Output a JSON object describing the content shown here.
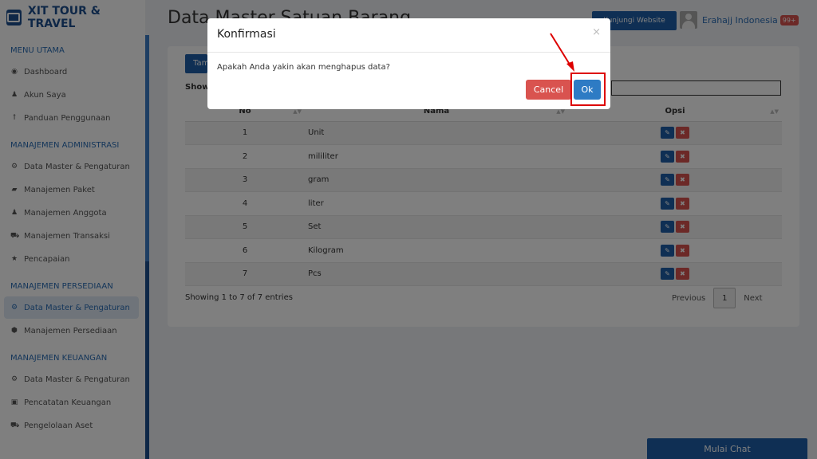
{
  "brand": {
    "name": "XIT TOUR & TRAVEL"
  },
  "sidebar": {
    "sections": [
      {
        "title": "MENU UTAMA",
        "items": [
          {
            "label": "Dashboard",
            "icon": "dashboard-icon"
          },
          {
            "label": "Akun Saya",
            "icon": "user-icon"
          },
          {
            "label": "Panduan Penggunaan",
            "icon": "lightbulb-icon"
          }
        ]
      },
      {
        "title": "MANAJEMEN ADMINISTRASI",
        "items": [
          {
            "label": "Data Master & Pengaturan",
            "icon": "cogs-icon"
          },
          {
            "label": "Manajemen Paket",
            "icon": "book-icon"
          },
          {
            "label": "Manajemen Anggota",
            "icon": "users-icon"
          },
          {
            "label": "Manajemen Transaksi",
            "icon": "cart-icon"
          },
          {
            "label": "Pencapaian",
            "icon": "star-icon"
          }
        ]
      },
      {
        "title": "MANAJEMEN PERSEDIAAN",
        "items": [
          {
            "label": "Data Master & Pengaturan",
            "icon": "cogs-icon",
            "active": true
          },
          {
            "label": "Manajemen Persediaan",
            "icon": "cubes-icon"
          }
        ]
      },
      {
        "title": "MANAJEMEN KEUANGAN",
        "items": [
          {
            "label": "Data Master & Pengaturan",
            "icon": "cogs-icon"
          },
          {
            "label": "Pencatatan Keuangan",
            "icon": "money-icon"
          },
          {
            "label": "Pengelolaan Aset",
            "icon": "car-icon"
          }
        ]
      }
    ]
  },
  "header": {
    "page_title": "Data Master Satuan Barang",
    "visit_label": "Kunjungi Website",
    "user_name": "Erahajj Indonesia",
    "badge": "99+"
  },
  "panel": {
    "add_label": "Tambah",
    "show_label": "Show",
    "columns": [
      "No",
      "Nama",
      "Opsi"
    ],
    "rows": [
      {
        "no": "1",
        "nama": "Unit"
      },
      {
        "no": "2",
        "nama": "mililiter"
      },
      {
        "no": "3",
        "nama": "gram"
      },
      {
        "no": "4",
        "nama": "liter"
      },
      {
        "no": "5",
        "nama": "Set"
      },
      {
        "no": "6",
        "nama": "Kilogram"
      },
      {
        "no": "7",
        "nama": "Pcs"
      }
    ],
    "info": "Showing 1 to 7 of 7 entries",
    "pager": {
      "previous": "Previous",
      "page": "1",
      "next": "Next"
    }
  },
  "chat": {
    "label": "Mulai Chat"
  },
  "modal": {
    "title": "Konfirmasi",
    "close": "×",
    "body": "Apakah Anda yakin akan menghapus data?",
    "cancel_label": "Cancel",
    "ok_label": "Ok"
  },
  "colors": {
    "primary": "#1f5fa8",
    "danger": "#d9534f",
    "highlight": "#dd0000"
  }
}
